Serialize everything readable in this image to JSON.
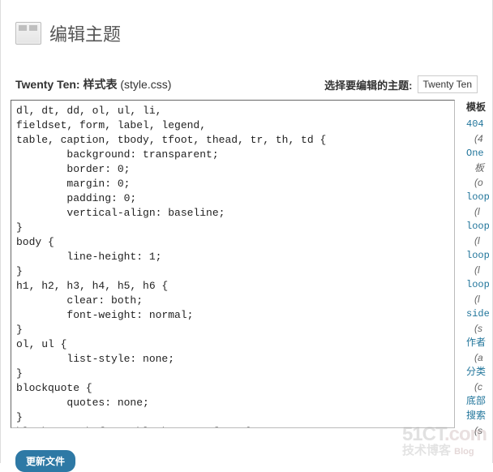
{
  "page": {
    "title": "编辑主题"
  },
  "theme_info": {
    "name": "Twenty Ten:",
    "stylesheet_label": "样式表",
    "stylesheet_file": "(style.css)"
  },
  "select_theme": {
    "label": "选择要编辑的主题:",
    "selected": "Twenty Ten"
  },
  "editor": {
    "content": "dl, dt, dd, ol, ul, li,\nfieldset, form, label, legend,\ntable, caption, tbody, tfoot, thead, tr, th, td {\n        background: transparent;\n        border: 0;\n        margin: 0;\n        padding: 0;\n        vertical-align: baseline;\n}\nbody {\n        line-height: 1;\n}\nh1, h2, h3, h4, h5, h6 {\n        clear: both;\n        font-weight: normal;\n}\nol, ul {\n        list-style: none;\n}\nblockquote {\n        quotes: none;\n}\nblockquote:before, blockquote:after {\n        content: '';\n        content: none;\n}"
  },
  "sidebar": {
    "header": "模板",
    "items": [
      {
        "label": "404",
        "sub": "(4"
      },
      {
        "label": "One",
        "sub": "板"
      },
      {
        "label": "",
        "sub": "(o"
      },
      {
        "label": "loop",
        "sub": "(l"
      },
      {
        "label": "loop",
        "sub": "(l"
      },
      {
        "label": "loop",
        "sub": "(l"
      },
      {
        "label": "loop",
        "sub": "(l"
      },
      {
        "label": "side",
        "sub": "(s"
      },
      {
        "label": "作者",
        "sub": "(a"
      },
      {
        "label": "分类",
        "sub": "(c"
      },
      {
        "label": "底部",
        "sub": ""
      },
      {
        "label": "搜索",
        "sub": "(s"
      }
    ]
  },
  "button": {
    "update": "更新文件"
  },
  "watermark": {
    "top_a": "51CT",
    "top_b": ".com",
    "bottom_a": "技术博客",
    "bottom_b": "Blog"
  }
}
